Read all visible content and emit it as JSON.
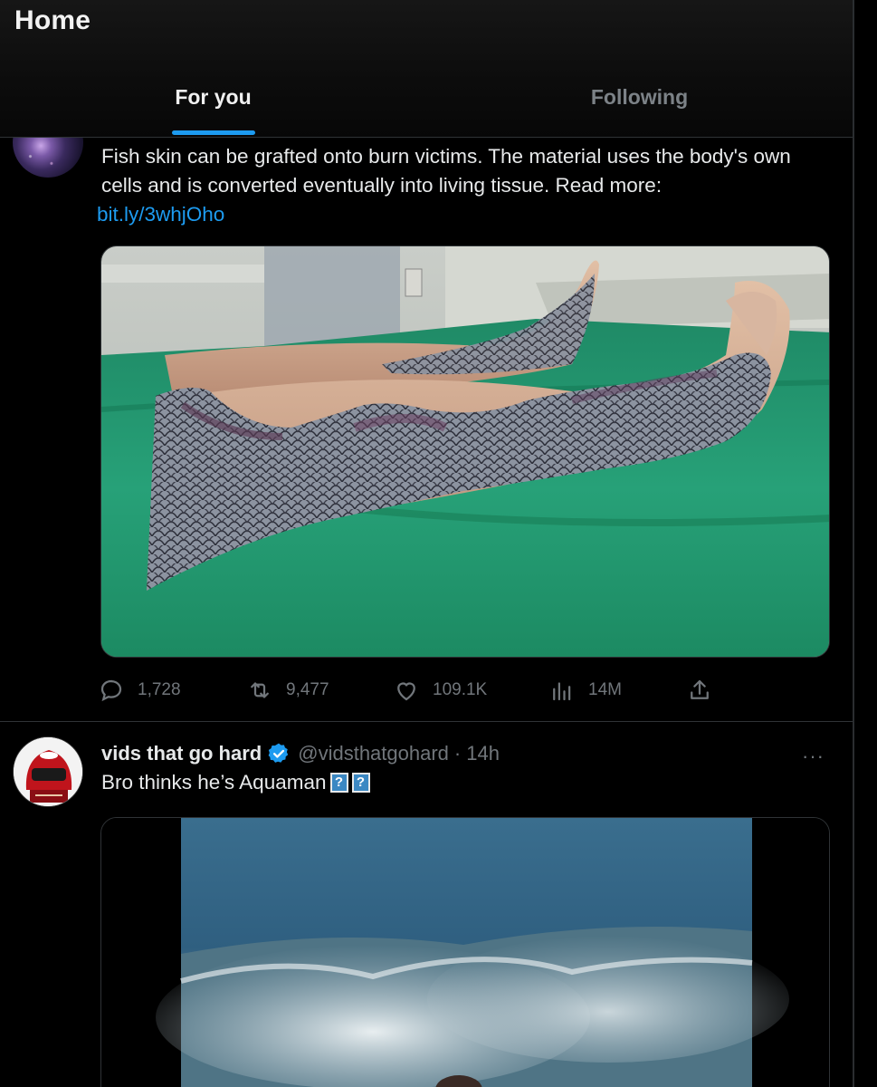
{
  "header": {
    "title": "Home",
    "tabs": [
      {
        "label": "For you",
        "active": true
      },
      {
        "label": "Following",
        "active": false
      }
    ],
    "accent_color": "#1d9bf0"
  },
  "tweets": [
    {
      "avatar_icon": "galaxy-avatar",
      "text": "Fish skin can be grafted onto burn victims. The material uses the body's own cells and is converted eventually into living tissue. Read more:",
      "link": "bit.ly/3whjOho",
      "media_icon": "photo-legs-fish-skin-graft",
      "actions": {
        "replies": "1,728",
        "retweets": "9,477",
        "likes": "109.1K",
        "views": "14M"
      }
    },
    {
      "avatar_icon": "red-helmet-avatar",
      "name": "vids that go hard",
      "handle": "@vidsthatgohard",
      "separator": "·",
      "time": "14h",
      "text": "Bro thinks he’s Aquaman",
      "emoji_placeholders": [
        "?",
        "?"
      ],
      "more_label": "···",
      "media_icon": "video-ocean-wave"
    }
  ]
}
